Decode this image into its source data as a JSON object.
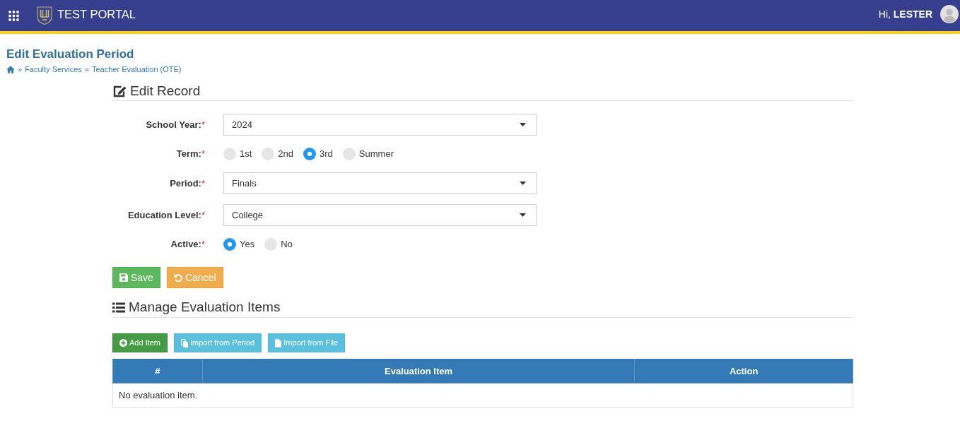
{
  "navbar": {
    "title": "TEST PORTAL",
    "greeting": "Hi,",
    "user": "LESTER"
  },
  "page": {
    "title": "Edit Evaluation Period",
    "breadcrumb": [
      {
        "separator": "»",
        "label": "Faculty Services"
      },
      {
        "separator": "»",
        "label": "Teacher Evaluation (OTE)"
      }
    ]
  },
  "edit_record": {
    "heading": "Edit Record",
    "fields": [
      {
        "kind": "select",
        "label": "School Year:",
        "required_mark": "*",
        "value": "2024"
      },
      {
        "kind": "radio",
        "label": "Term:",
        "required_mark": "*",
        "options": [
          {
            "label": "1st",
            "selected": false
          },
          {
            "label": "2nd",
            "selected": false
          },
          {
            "label": "3rd",
            "selected": true
          },
          {
            "label": "Summer",
            "selected": false
          }
        ]
      },
      {
        "kind": "select",
        "label": "Period:",
        "required_mark": "*",
        "value": "Finals"
      },
      {
        "kind": "select",
        "label": "Education Level:",
        "required_mark": "*",
        "value": "College"
      },
      {
        "kind": "radio",
        "label": "Active:",
        "required_mark": "*",
        "options": [
          {
            "label": "Yes",
            "selected": true
          },
          {
            "label": "No",
            "selected": false
          }
        ]
      }
    ],
    "buttons": [
      {
        "kind": "save",
        "label": "Save"
      },
      {
        "kind": "cancel",
        "label": "Cancel"
      }
    ]
  },
  "evaluation_items": {
    "heading": "Manage Evaluation Items",
    "buttons": [
      {
        "kind": "add",
        "label": "Add Item",
        "hovered": true
      },
      {
        "kind": "import-period",
        "label": "Import from Period",
        "hovered": false
      },
      {
        "kind": "import-file",
        "label": "Import from File",
        "hovered": false
      }
    ],
    "table": {
      "columns": [
        "#",
        "Evaluation Item",
        "Action"
      ],
      "empty_message": "No evaluation item."
    }
  }
}
